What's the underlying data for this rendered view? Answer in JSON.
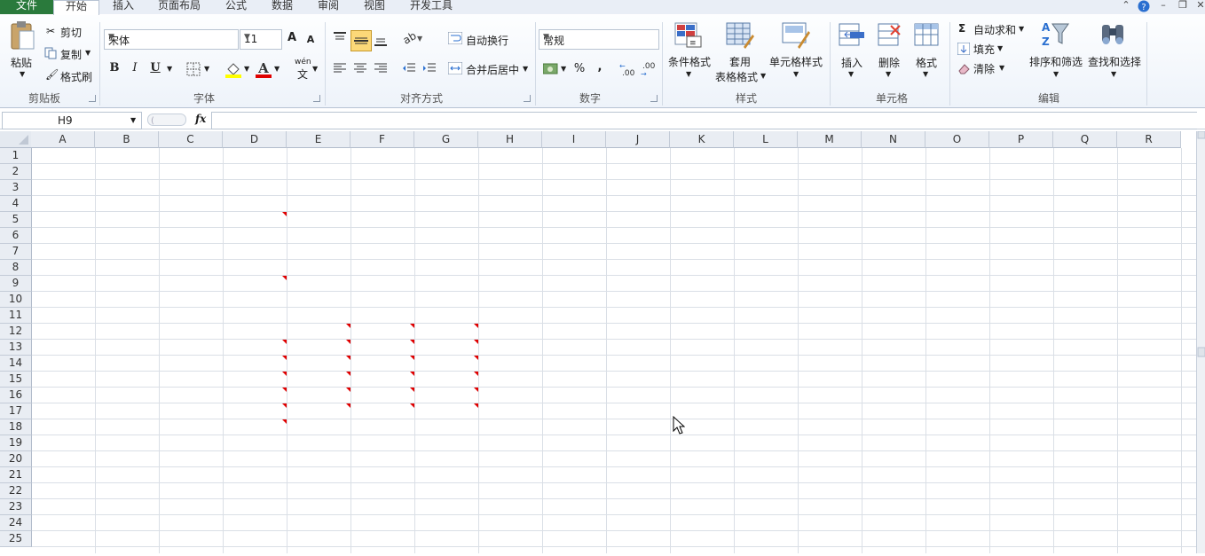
{
  "tabs": [
    "文件",
    "开始",
    "插入",
    "页面布局",
    "公式",
    "数据",
    "审阅",
    "视图",
    "开发工具"
  ],
  "clipboard": {
    "paste": "粘贴",
    "cut": "剪切",
    "copy": "复制",
    "format_painter": "格式刷",
    "group": "剪贴板"
  },
  "font": {
    "name": "宋体",
    "size": "11",
    "bold": "B",
    "italic": "I",
    "underline": "U",
    "group": "字体",
    "grow": "A",
    "shrink": "A",
    "wen": "wén",
    "wen_char": "文"
  },
  "align": {
    "wrap": "自动换行",
    "merge": "合并后居中",
    "group": "对齐方式"
  },
  "number": {
    "format": "常规",
    "percent": "%",
    "comma": ",",
    "group": "数字"
  },
  "styles": {
    "cond_format": "条件格式",
    "table_format_1": "套用",
    "table_format_2": "表格格式",
    "cell_styles": "单元格样式",
    "group": "样式"
  },
  "cells": {
    "insert": "插入",
    "delete": "删除",
    "format": "格式",
    "group": "单元格"
  },
  "editing": {
    "autosum": "自动求和",
    "fill": "填充",
    "clear": "清除",
    "sort": "排序和筛选",
    "find": "查找和选择",
    "group": "编辑"
  },
  "formula_bar": {
    "name_box": "H9",
    "fx": "fx",
    "content": ""
  },
  "columns": [
    "A",
    "B",
    "C",
    "D",
    "E",
    "F",
    "G",
    "H",
    "I",
    "J",
    "K",
    "L",
    "M",
    "N",
    "O",
    "P",
    "Q",
    "R"
  ],
  "rows": [
    "1",
    "2",
    "3",
    "4",
    "5",
    "6",
    "7",
    "8",
    "9",
    "10",
    "11",
    "12",
    "13",
    "14",
    "15",
    "16",
    "17",
    "18",
    "19",
    "20",
    "21",
    "22",
    "23",
    "24",
    "25"
  ],
  "comment_cells": [
    "D5",
    "D9",
    "D13",
    "D14",
    "D15",
    "D16",
    "D17",
    "D18",
    "E12",
    "E13",
    "E14",
    "E15",
    "E16",
    "E17",
    "F12",
    "F13",
    "F14",
    "F15",
    "F16",
    "F17",
    "G12",
    "G13",
    "G14",
    "G15",
    "G16",
    "G17"
  ],
  "colors": {
    "file_tab": "#2a7a3c",
    "comment_marker": "#e00000",
    "highlight_button": "#fcd878"
  }
}
